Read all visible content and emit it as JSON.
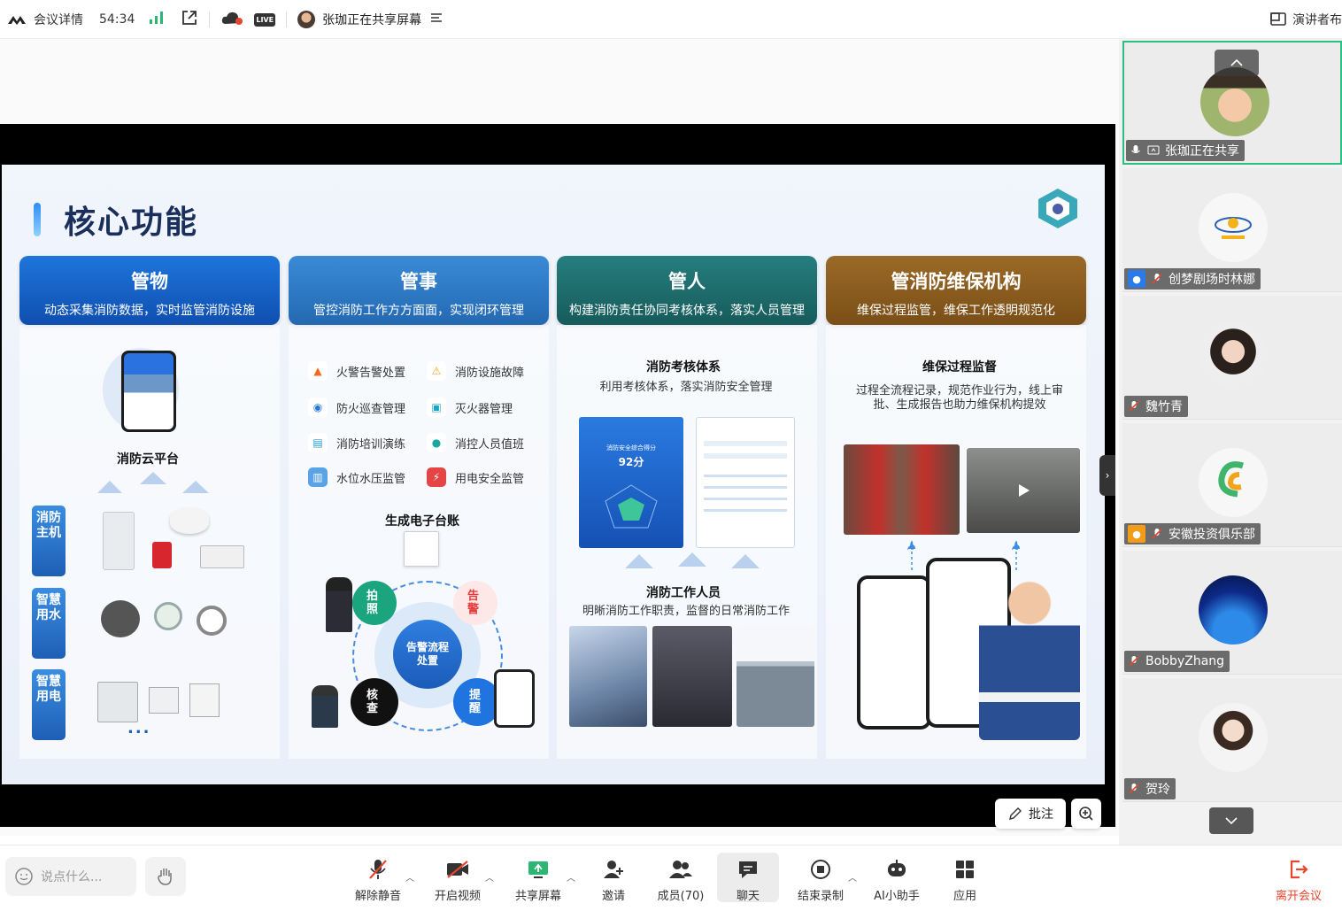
{
  "topbar": {
    "meeting_details": "会议详情",
    "timer": "54:34",
    "live_badge": "LIVE",
    "sharing_status": "张珈正在共享屏幕",
    "presenter_layout": "演讲者布"
  },
  "slide": {
    "title": "核心功能",
    "columns": [
      {
        "title": "管物",
        "subtitle": "动态采集消防数据，实时监管消防设施",
        "color": "#1560c8"
      },
      {
        "title": "管事",
        "subtitle": "管控消防工作方方面面，实现闭环管理",
        "color": "#2a78c6"
      },
      {
        "title": "管人",
        "subtitle": "构建消防责任协同考核体系，落实人员管理",
        "color": "#1d6b6b"
      },
      {
        "title": "管消防维保机构",
        "subtitle": "维保过程监管，维保工作透明规范化",
        "color": "#8a5a1c"
      }
    ],
    "col1": {
      "platform": "消防云平台",
      "tags": [
        "消防主机",
        "智慧用水",
        "智慧用电"
      ],
      "more": "..."
    },
    "col2": {
      "items": [
        "火警告警处置",
        "消防设施故障",
        "防火巡查管理",
        "灭火器管理",
        "消防培训演练",
        "消控人员值班",
        "水位水压监管",
        "用电安全监管"
      ],
      "ledger": "生成电子台账",
      "cycle": {
        "photo": "拍照",
        "alarm": "告警",
        "center": "告警流程处置",
        "check": "核查",
        "remind": "提醒"
      }
    },
    "col3": {
      "assess_title": "消防考核体系",
      "assess_desc": "利用考核体系，落实消防安全管理",
      "score_label": "消防安全综合得分",
      "score": "92分",
      "staff_title": "消防工作人员",
      "staff_desc": "明晰消防工作职责，监督的日常消防工作"
    },
    "col4": {
      "title": "维保过程监督",
      "desc": "过程全流程记录，规范作业行为，线上审批、生成报告也助力维保机构提效"
    }
  },
  "stage_controls": {
    "annotate": "批注"
  },
  "participants": [
    {
      "name": "张珈正在共享",
      "active": true
    },
    {
      "name": "创梦剧场时林娜",
      "active": false
    },
    {
      "name": "魏竹青",
      "active": false
    },
    {
      "name": "安徽投资俱乐部",
      "active": false
    },
    {
      "name": "BobbyZhang",
      "active": false
    },
    {
      "name": "贺玲",
      "active": false
    }
  ],
  "bottombar": {
    "chat_placeholder": "说点什么...",
    "tools": [
      "解除静音",
      "开启视频",
      "共享屏幕",
      "邀请",
      "成员(70)",
      "聊天",
      "结束录制",
      "AI小助手",
      "应用"
    ],
    "leave": "离开会议"
  },
  "colors": {
    "accent_green": "#2bbf84",
    "leave_red": "#e8452c",
    "signal_green": "#2bb673"
  }
}
